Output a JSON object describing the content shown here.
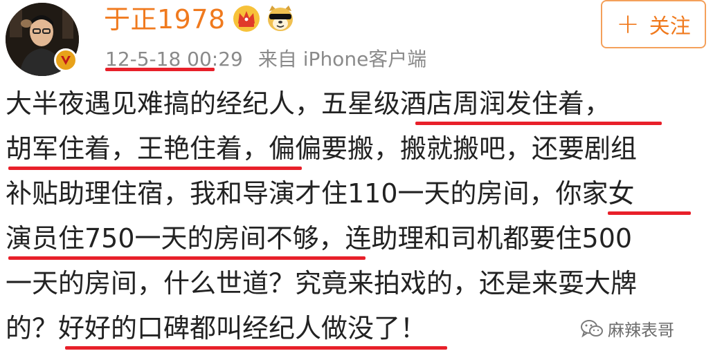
{
  "post": {
    "username": "于正1978",
    "timestamp": "12-5-18 00:29",
    "source": "来自 iPhone客户端",
    "follow_label": "关注",
    "follow_plus": "+",
    "content_lines": [
      "大半夜遇见难搞的经纪人，五星级酒店周润发住着，",
      "胡军住着，王艳住着，偏偏要搬，搬就搬吧，还要剧组",
      "补贴助理住宿，我和导演才住110一天的房间，你家女",
      "演员住750一天的房间不够，连助理和司机都要住500",
      "一天的房间，什么世道？究竟来拍戏的，还是来耍大牌",
      "的？好好的口碑都叫经纪人做没了！"
    ]
  },
  "watermark": {
    "text": "麻辣表哥",
    "icon": "wechat-icon"
  },
  "icons": [
    "crown-icon",
    "dog-emoji-icon",
    "verified-badge-icon",
    "avatar"
  ],
  "colors": {
    "username": "#f07a1e",
    "follow_border": "#f4a05a",
    "highlight_underline": "#e8202a",
    "meta_text": "#8a8a8a",
    "verified_badge": "#e8a21a"
  }
}
